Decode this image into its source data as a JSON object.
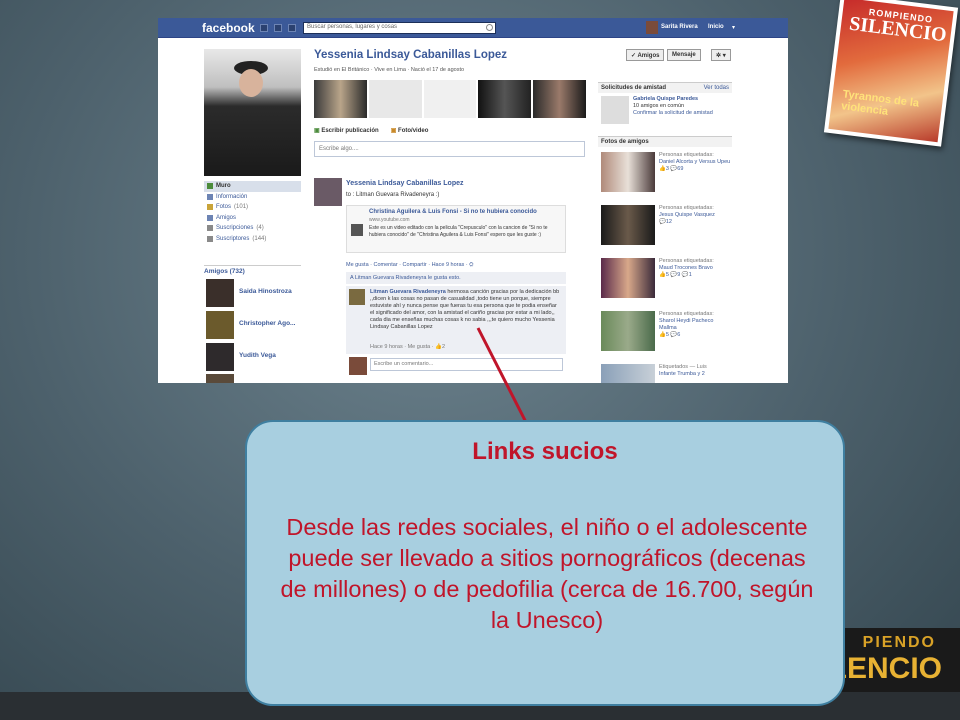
{
  "facebook": {
    "logo": "facebook",
    "search_placeholder": "Buscar personas, lugares y cosas",
    "user_name": "Sarita Rivera",
    "home_label": "Inicio",
    "profile": {
      "name": "Yessenia Lindsay Cabanillas Lopez",
      "studied": "Estudió en El Británico",
      "lives": "Vive en Lima",
      "born": "Nació el 17 de agosto",
      "friends_button": "✓ Amigos",
      "message_button": "Mensaje",
      "settings_button": "✲ ▾"
    },
    "composer": {
      "write_tab": "Escribir publicación",
      "photo_tab": "Foto/video",
      "placeholder": "Escribe algo...."
    },
    "nav": {
      "items": [
        {
          "label": "Muro",
          "count": ""
        },
        {
          "label": "Información",
          "count": ""
        },
        {
          "label": "Fotos",
          "count": "(101)"
        },
        {
          "label": "Amigos",
          "count": ""
        },
        {
          "label": "Suscripciones",
          "count": "(4)"
        },
        {
          "label": "Suscriptores",
          "count": "(144)"
        }
      ],
      "friends_header": "Amigos (732)",
      "friends": [
        "Saida Hinostroza",
        "Christopher Ago...",
        "Yudith Vega"
      ]
    },
    "post": {
      "author": "Yessenia Lindsay Cabanillas Lopez",
      "to": "to : Litman Guevara Rivadeneyra :)",
      "link_title": "Christina Aguilera & Luis Fonsi - Si no te hubiera conocido",
      "link_url": "www.youtube.com",
      "link_desc": "Este es un video editado con la pelicula \"Crepusculo\" con la cancion de \"Si no te hubiera conocido\" de \"Christina Aguilera & Luis Fonsi\" espero que les guste :)",
      "actions": "Me gusta · Comentar · Compartir · Hace 9 horas · ⛭",
      "likes": "A Litman Guevara Rivadeneyra le gusta esto.",
      "comment_author": "Litman Guevara Rivadeneyra",
      "comment_text": "hermosa canción gracias por la dedicación bb ,,dicen k las cosas no pasan de casualidad ,todo tiene un porque, siempre estuviste ahí y nunca pense que fueras tu esa persona que te podia enseñar el significado del amor, con la amistad el cariño gracias por estar a mi lado,, cada dia me enseñas muchas cosas k no sabia ,,,te quiero mucho Yessenia Lindsay Cabanillas Lopez",
      "comment_meta": "Hace 9 horas · Me gusta · 👍2",
      "reply_placeholder": "Escribe un comentario..."
    },
    "right": {
      "requests_header": "Solicitudes de amistad",
      "see_all": "Ver todas",
      "request_name": "Gabriela Quispe Paredes",
      "request_info": "10 amigos en común",
      "request_confirm": "Confirmar la solicitud de amistad",
      "photos_header": "Fotos de amigos",
      "photos": [
        {
          "tagged": "Personas etiquetadas:",
          "who": "Daniel Alcorta y Versus Upeu",
          "stats": "👍3  💬69"
        },
        {
          "tagged": "Personas etiquetadas:",
          "who": "Jesus Quispe Vasquez",
          "stats": "💬12"
        },
        {
          "tagged": "Personas etiquetadas:",
          "who": "Maud Trocones Bravo",
          "stats": "👍5  💬9  💬1"
        },
        {
          "tagged": "Personas etiquetadas:",
          "who": "Sharol Heydi Pacheco Mallma",
          "stats": "👍5  💬6"
        },
        {
          "tagged": "Etiquetados — Luis",
          "who": "Infante Trumba y 2",
          "stats": ""
        }
      ]
    }
  },
  "magazine": {
    "top": "ROMPIENDO",
    "title": "SILENCIO",
    "subtitle": "Tyrannos de la violencia"
  },
  "brand": {
    "top": "PIENDO",
    "bottom": "LENCIO"
  },
  "callout": {
    "title": "Links sucios",
    "body": "Desde las redes sociales, el niño o el adolescente puede ser llevado a sitios pornográficos (decenas de millones) o de pedofilia (cerca de 16.700, según la Unesco)"
  },
  "colors": {
    "facebook_blue": "#3b5998",
    "callout_bg": "#a8cfe0",
    "callout_text": "#c0152a",
    "pointer": "#c0152a"
  }
}
